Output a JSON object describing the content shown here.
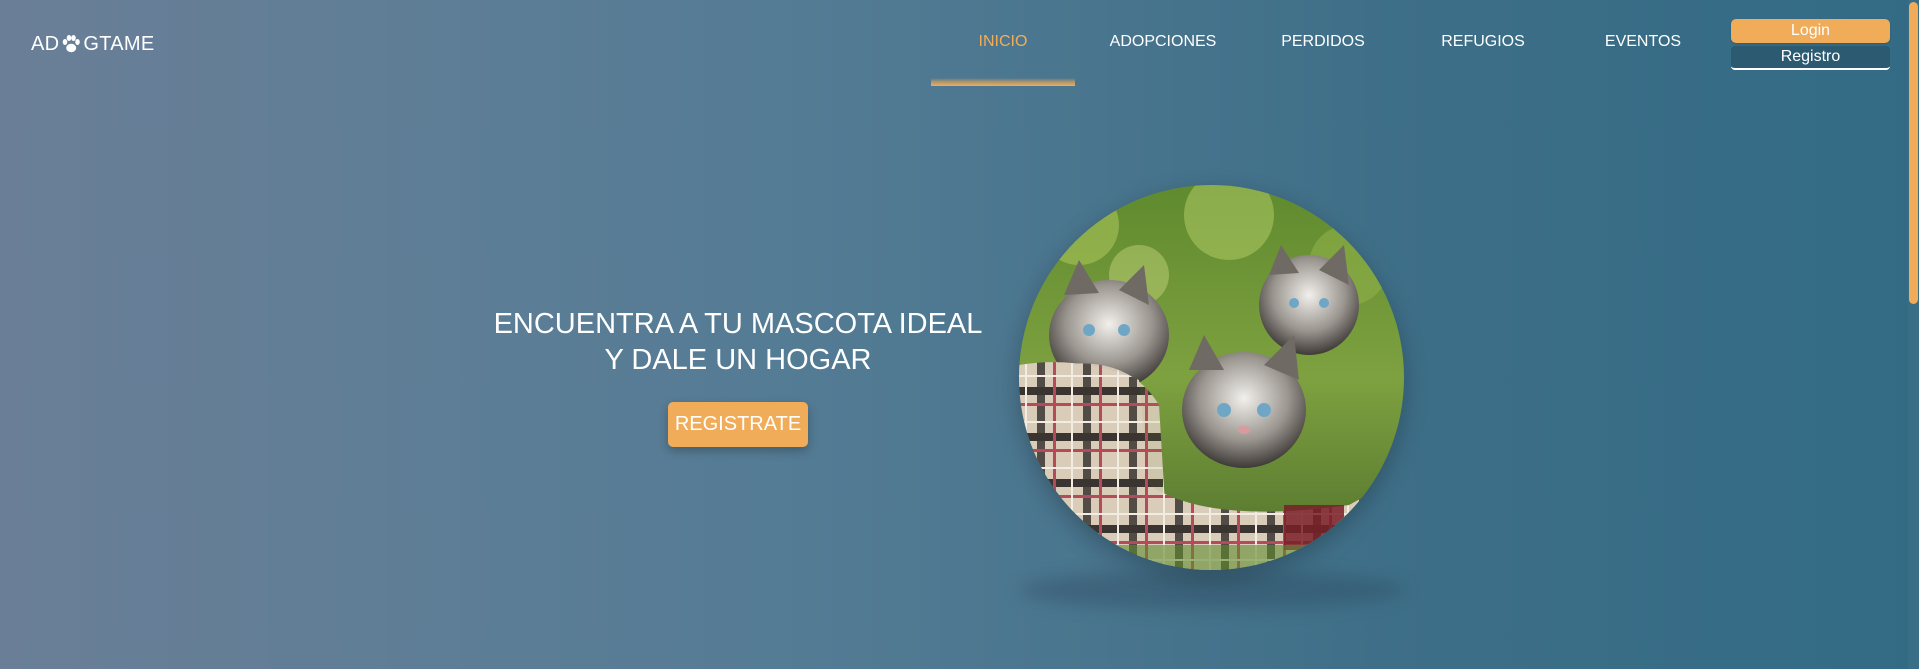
{
  "brand": {
    "name_prefix": "AD",
    "name_suffix": "GTAME",
    "logo_icon": "paw-icon"
  },
  "nav": {
    "items": [
      {
        "label": "INICIO",
        "active": true
      },
      {
        "label": "ADOPCIONES",
        "active": false
      },
      {
        "label": "PERDIDOS",
        "active": false
      },
      {
        "label": "REFUGIOS",
        "active": false
      },
      {
        "label": "EVENTOS",
        "active": false
      }
    ]
  },
  "auth": {
    "login_label": "Login",
    "register_label": "Registro"
  },
  "hero": {
    "headline_line1": "ENCUENTRA A TU MASCOTA IDEAL",
    "headline_line2": "Y DALE UN HOGAR",
    "cta_label": "REGISTRATE",
    "image_subject": "kittens-in-plaid-basket"
  },
  "colors": {
    "accent": "#f0ac59",
    "nav_active": "#f3ad56",
    "registro_bg": "#2b5a71",
    "bg_left": "#6a7f97",
    "bg_right": "#336b85"
  }
}
